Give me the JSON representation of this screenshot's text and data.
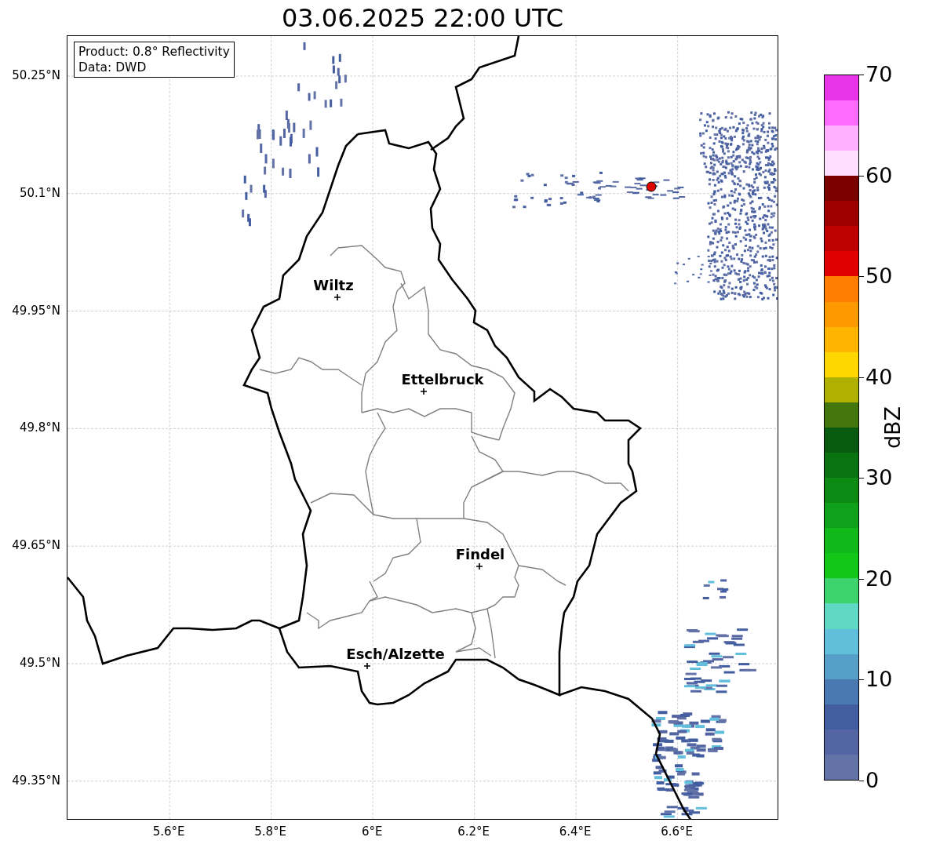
{
  "title": "03.06.2025 22:00 UTC",
  "info_box": {
    "lines": [
      "Product: 0.8° Reflectivity",
      "Data: DWD"
    ]
  },
  "y_axis": {
    "ticks": [
      "50.25°N",
      "50.1°N",
      "49.95°N",
      "49.8°N",
      "49.65°N",
      "49.5°N",
      "49.35°N"
    ]
  },
  "x_axis": {
    "ticks": [
      "5.6°E",
      "5.8°E",
      "6°E",
      "6.2°E",
      "6.4°E",
      "6.6°E"
    ]
  },
  "cities": [
    {
      "name": "Wiltz"
    },
    {
      "name": "Ettelbruck"
    },
    {
      "name": "Findel"
    },
    {
      "name": "Esch/Alzette"
    }
  ],
  "colorbar": {
    "label": "dBZ",
    "ticks": [
      "70",
      "60",
      "50",
      "40",
      "30",
      "20",
      "10",
      "0"
    ],
    "bins": [
      {
        "color": "#6373a8"
      },
      {
        "color": "#5366a3"
      },
      {
        "color": "#425da0"
      },
      {
        "color": "#4a78b0"
      },
      {
        "color": "#569fc8"
      },
      {
        "color": "#61bfdc"
      },
      {
        "color": "#5fd8c4"
      },
      {
        "color": "#3dd46d"
      },
      {
        "color": "#12c718"
      },
      {
        "color": "#10b81a"
      },
      {
        "color": "#0fa119"
      },
      {
        "color": "#0d8a14"
      },
      {
        "color": "#0a7311"
      },
      {
        "color": "#085a0f"
      },
      {
        "color": "#43760c"
      },
      {
        "color": "#b0b003"
      },
      {
        "color": "#ffd600"
      },
      {
        "color": "#ffb400"
      },
      {
        "color": "#ff9900"
      },
      {
        "color": "#ff7d00"
      },
      {
        "color": "#e00000"
      },
      {
        "color": "#bf0000"
      },
      {
        "color": "#9e0000"
      },
      {
        "color": "#7a0000"
      },
      {
        "color": "#ffdeff"
      },
      {
        "color": "#ffb0ff"
      },
      {
        "color": "#ff6bff"
      },
      {
        "color": "#e935e9"
      }
    ]
  }
}
